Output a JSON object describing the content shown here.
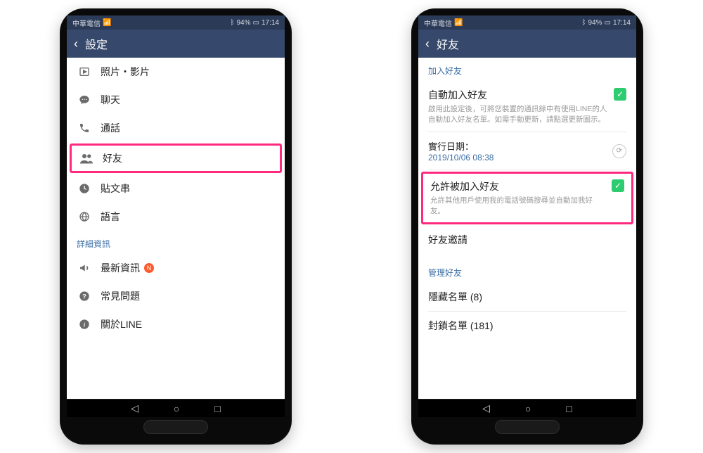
{
  "status": {
    "carrier": "中華電信",
    "battery": "94%",
    "time": "17:14"
  },
  "left": {
    "title": "設定",
    "items": {
      "photos": "照片・影片",
      "chat": "聊天",
      "calls": "通話",
      "friends": "好友",
      "timeline": "貼文串",
      "language": "語言"
    },
    "details_section": "詳細資訊",
    "details": {
      "news": "最新資訊",
      "news_badge": "N",
      "faq": "常見問題",
      "about": "關於LINE"
    }
  },
  "right": {
    "title": "好友",
    "add_section": "加入好友",
    "auto_add": {
      "title": "自動加入好友",
      "desc": "啟用此設定後，可將您裝置的通訊錄中有使用LINE的人自動加入好友名單。如需手動更新，請點選更新圖示。"
    },
    "effective_date_label": "實行日期：",
    "effective_date_value": "2019/10/06 08:38",
    "allow_added": {
      "title": "允許被加入好友",
      "desc": "允許其他用戶使用我的電話號碼搜尋並自動加我好友。"
    },
    "friend_invite": "好友邀請",
    "manage_section": "管理好友",
    "hidden_list": "隱藏名單 (8)",
    "blocked_list": "封鎖名單 (181)"
  }
}
